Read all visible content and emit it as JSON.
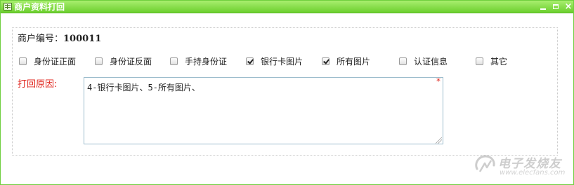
{
  "window": {
    "title": "商户资料打回",
    "icon": "table-icon",
    "buttons": {
      "minimize": "minimize-icon",
      "maximize": "maximize-icon",
      "close": "×"
    }
  },
  "merchant": {
    "label": "商户编号：",
    "value": "100011"
  },
  "options": [
    {
      "label": "身份证正面",
      "checked": false
    },
    {
      "label": "身份证反面",
      "checked": false
    },
    {
      "label": "手持身份证",
      "checked": false
    },
    {
      "label": "银行卡图片",
      "checked": true
    },
    {
      "label": "所有图片",
      "checked": true
    },
    {
      "label": "认证信息",
      "checked": false
    },
    {
      "label": "其它",
      "checked": false
    }
  ],
  "reason": {
    "label": "打回原因:",
    "value": "4-银行卡图片、5-所有图片、",
    "required_mark": "*"
  },
  "watermark": {
    "text": "电子发烧友",
    "url": "www.elecfans.com"
  },
  "colors": {
    "titlebar": "#6ccf2e",
    "border": "#6fcf3e",
    "reason_label": "#e0261e",
    "required": "#e0261e"
  }
}
